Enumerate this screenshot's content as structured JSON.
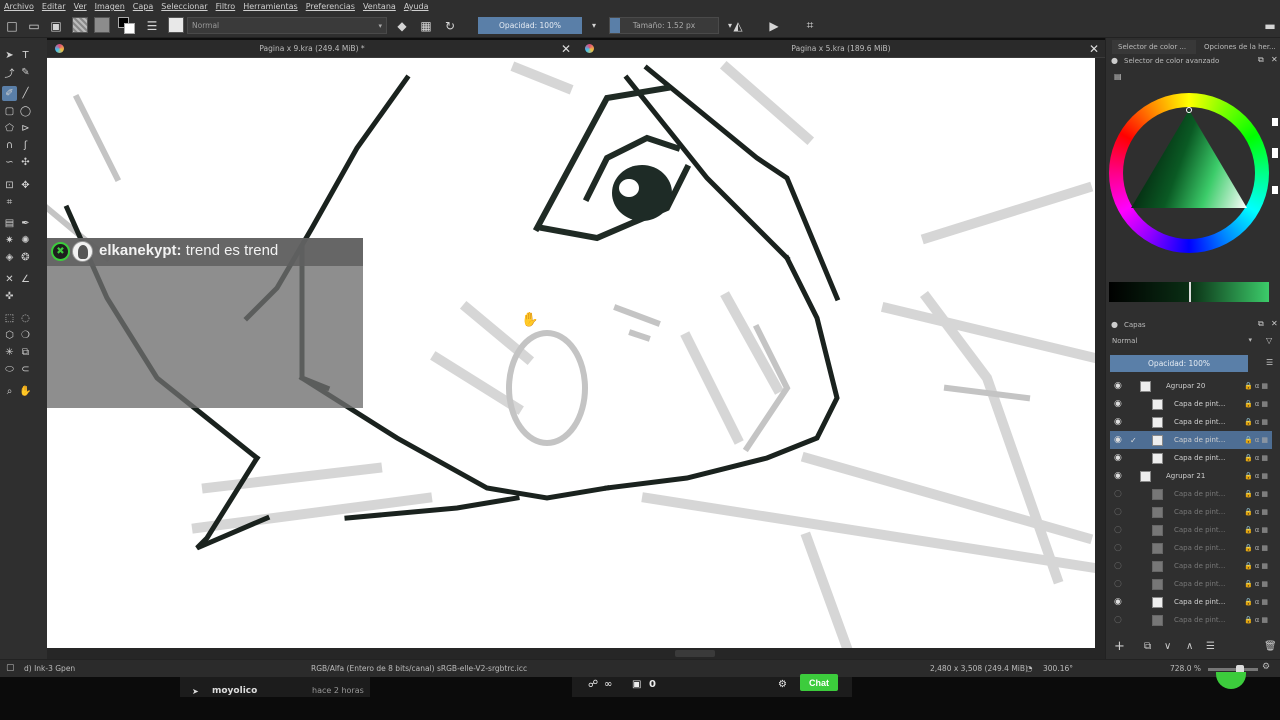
{
  "menu": [
    "Archivo",
    "Editar",
    "Ver",
    "Imagen",
    "Capa",
    "Seleccionar",
    "Filtro",
    "Herramientas",
    "Preferencias",
    "Ventana",
    "Ayuda"
  ],
  "toolbar": {
    "blend_mode": "Normal",
    "opacity_label": "Opacidad: 100%",
    "size_label": "Tamaño: 1.52 px",
    "opacity_value": 1.0
  },
  "documents": [
    {
      "title": "Pagina x 9.kra (249.4 MiB) *"
    },
    {
      "title": "Pagina x 5.kra (189.6 MiB)"
    }
  ],
  "chat_overlay": {
    "username": "elkanekypt:",
    "message": "trend es trend",
    "badge_color": "#3ccc3c"
  },
  "dock": {
    "tabs": [
      "Selector de color ...",
      "Opciones de la her..."
    ],
    "color_panel_title": "Selector de color avanzado",
    "layers_panel_title": "Capas",
    "layers_blend": "Normal",
    "layers_opacity": "Opacidad:  100%",
    "layers": [
      {
        "name": "Agrupar 20",
        "type": "group",
        "visible": true,
        "dim": false
      },
      {
        "name": "Capa de pint...",
        "type": "paint",
        "visible": true,
        "dim": false
      },
      {
        "name": "Capa de pint...",
        "type": "paint",
        "visible": true,
        "dim": false
      },
      {
        "name": "Capa de pint...",
        "type": "paint",
        "visible": true,
        "dim": false,
        "selected": true
      },
      {
        "name": "Capa de pint...",
        "type": "paint",
        "visible": true,
        "dim": false
      },
      {
        "name": "Agrupar 21",
        "type": "group",
        "visible": true,
        "dim": false
      },
      {
        "name": "Capa de pint...",
        "type": "paint",
        "visible": false,
        "dim": true
      },
      {
        "name": "Capa de pint...",
        "type": "paint",
        "visible": false,
        "dim": true
      },
      {
        "name": "Capa de pint...",
        "type": "paint",
        "visible": false,
        "dim": true
      },
      {
        "name": "Capa de pint...",
        "type": "paint",
        "visible": false,
        "dim": true
      },
      {
        "name": "Capa de pint...",
        "type": "paint",
        "visible": false,
        "dim": true
      },
      {
        "name": "Capa de pint...",
        "type": "paint",
        "visible": false,
        "dim": true
      },
      {
        "name": "Capa de pint...",
        "type": "paint",
        "visible": true,
        "dim": false
      },
      {
        "name": "Capa de pint...",
        "type": "paint",
        "visible": false,
        "dim": true
      }
    ],
    "accent_color": "#3ccc6a"
  },
  "status": {
    "brush": "d) Ink-3 Gpen",
    "color_space": "RGB/Alfa (Entero de 8 bits/canal)  sRGB-elle-V2-srgbtrc.icc",
    "dimensions": "2,480 x 3,508 (249.4 MiB)",
    "rotation": "300.16°",
    "zoom": "728.0 %"
  },
  "stream": {
    "chat_button": "Chat",
    "recent_user": "moyolico",
    "recent_time": "hace 2 horas",
    "count": "0"
  }
}
